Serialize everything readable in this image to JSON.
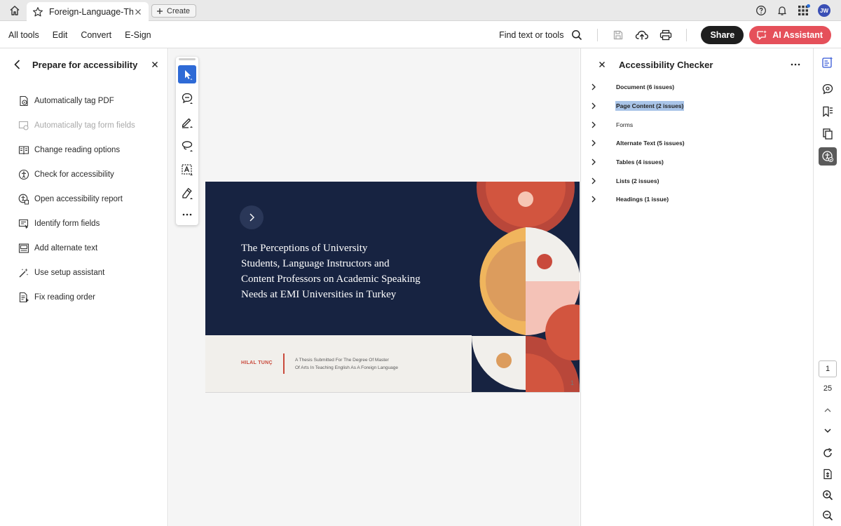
{
  "tabbar": {
    "tab_title": "Foreign-Language-The...",
    "create_label": "Create",
    "avatar_initials": "JW"
  },
  "toolbar": {
    "menu": [
      "All tools",
      "Edit",
      "Convert",
      "E-Sign"
    ],
    "find_label": "Find text or tools",
    "share_label": "Share",
    "ai_label": "AI Assistant"
  },
  "left_panel": {
    "title": "Prepare for accessibility",
    "items": [
      {
        "label": "Automatically tag PDF",
        "icon": "tag-pdf-icon",
        "enabled": true
      },
      {
        "label": "Automatically tag form fields",
        "icon": "tag-form-icon",
        "enabled": false
      },
      {
        "label": "Change reading options",
        "icon": "reading-options-icon",
        "enabled": true
      },
      {
        "label": "Check for accessibility",
        "icon": "accessibility-check-icon",
        "enabled": true
      },
      {
        "label": "Open accessibility report",
        "icon": "accessibility-report-icon",
        "enabled": true
      },
      {
        "label": "Identify form fields",
        "icon": "form-fields-icon",
        "enabled": true
      },
      {
        "label": "Add alternate text",
        "icon": "alt-text-icon",
        "enabled": true
      },
      {
        "label": "Use setup assistant",
        "icon": "setup-assistant-icon",
        "enabled": true
      },
      {
        "label": "Fix reading order",
        "icon": "reading-order-icon",
        "enabled": true
      }
    ]
  },
  "document": {
    "title_lines": [
      "The Perceptions of University",
      "Students, Language Instructors and",
      "Content Professors on Academic Speaking",
      "Needs at EMI Universities in Turkey"
    ],
    "author": "HILAL TUNÇ",
    "thesis_lines": [
      "A Thesis Submitted For The Degree Of Master",
      "Of Arts In Teaching English As A Foreign Language"
    ],
    "page_number": "1",
    "colors": {
      "navy": "#172341",
      "coral": "#d2553f",
      "orange": "#f0b55d",
      "cream": "#f1efeb",
      "pink": "#f4c2b7"
    }
  },
  "right_panel": {
    "title": "Accessibility Checker",
    "items": [
      {
        "label": "Document (6 issues)",
        "style": "bold"
      },
      {
        "label": "Page Content (2 issues)",
        "style": "selected"
      },
      {
        "label": "Forms",
        "style": "plain"
      },
      {
        "label": "Alternate Text (5 issues)",
        "style": "bold"
      },
      {
        "label": "Tables (4 issues)",
        "style": "bold"
      },
      {
        "label": "Lists (2 issues)",
        "style": "bold"
      },
      {
        "label": "Headings (1 issue)",
        "style": "bold"
      }
    ]
  },
  "rail": {
    "current_page": "1",
    "total_pages": "25"
  }
}
